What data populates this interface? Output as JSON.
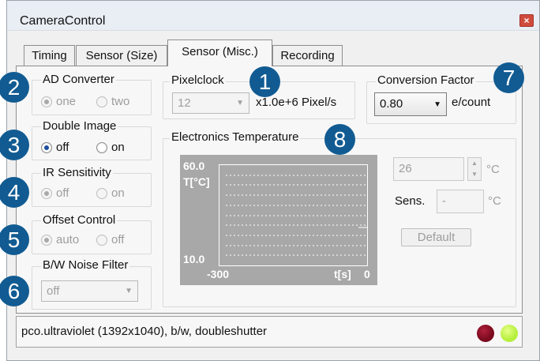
{
  "window": {
    "title": "CameraControl",
    "close_symbol": "×"
  },
  "tabs": [
    {
      "label": "Timing"
    },
    {
      "label": "Sensor (Size)"
    },
    {
      "label": "Sensor (Misc.)",
      "active": true
    },
    {
      "label": "Recording"
    }
  ],
  "badges": [
    "1",
    "2",
    "3",
    "4",
    "5",
    "6",
    "7",
    "8"
  ],
  "ad_converter": {
    "legend": "AD Converter",
    "options": [
      "one",
      "two"
    ],
    "selected": "one",
    "enabled": false
  },
  "double_image": {
    "legend": "Double Image",
    "options": [
      "off",
      "on"
    ],
    "selected": "off",
    "enabled": true
  },
  "ir_sensitivity": {
    "legend": "IR Sensitivity",
    "options": [
      "off",
      "on"
    ],
    "selected": "off",
    "enabled": false
  },
  "offset_control": {
    "legend": "Offset Control",
    "options": [
      "auto",
      "off"
    ],
    "selected": "auto",
    "enabled": false
  },
  "bw_noise_filter": {
    "legend": "B/W Noise Filter",
    "value": "off",
    "enabled": false
  },
  "pixelclock": {
    "legend": "Pixelclock",
    "value": "12",
    "unit": "x1.0e+6 Pixel/s",
    "enabled": false
  },
  "conversion_factor": {
    "legend": "Conversion Factor",
    "value": "0.80",
    "unit": "e/count",
    "enabled": true
  },
  "electronics_temperature": {
    "legend": "Electronics Temperature",
    "setpoint": "26",
    "setpoint_unit": "°C",
    "sens_label": "Sens.",
    "sens_value": "-",
    "sens_unit": "°C",
    "default_button": "Default",
    "plot": {
      "y_max_label": "60.0",
      "y_min_label": "10.0",
      "y_axis_label": "T[°C]",
      "x_min_label": "-300",
      "x_axis_label": "t[s]",
      "x_max_label": "0"
    }
  },
  "status": {
    "text": "pco.ultraviolet (1392x1040), b/w, doubleshutter",
    "led_colors": [
      "#7a0a1e",
      "#b6ef3c"
    ]
  },
  "colors": {
    "badge": "#115b92",
    "plot_bg": "#a8a8a8"
  }
}
